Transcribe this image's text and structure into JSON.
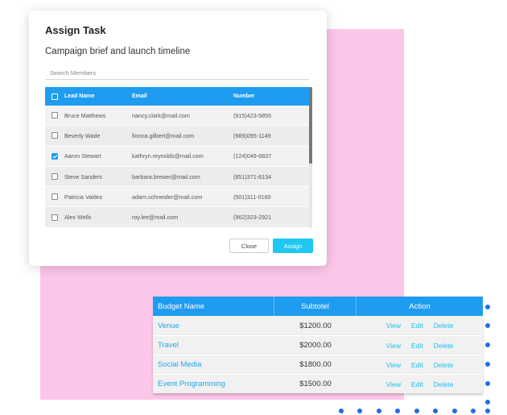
{
  "dialog": {
    "title": "Assign Task",
    "subtitle": "Campaign brief and launch timeline",
    "search_placeholder": "Search Members",
    "columns": [
      "Lead Name",
      "Email",
      "Number"
    ],
    "members": [
      {
        "name": "Bruce Matthews",
        "email": "nancy.clark@mail.com",
        "number": "(915)423-5855",
        "checked": false
      },
      {
        "name": "Beverly Wade",
        "email": "fionna.gilbert@mail.com",
        "number": "(989)095-1149",
        "checked": false
      },
      {
        "name": "Aaron Stewart",
        "email": "kathryn.reynolds@mail.com",
        "number": "(124)049-6837",
        "checked": true
      },
      {
        "name": "Steve Sanders",
        "email": "barbara.brewer@mail.com",
        "number": "(851)371-8134",
        "checked": false
      },
      {
        "name": "Patricia Valdez",
        "email": "adam.schneider@mail.com",
        "number": "(501)311-0160",
        "checked": false
      },
      {
        "name": "Alex Wells",
        "email": "roy.lee@mail.com",
        "number": "(962)323-2921",
        "checked": false
      }
    ],
    "close_label": "Close",
    "assign_label": "Assign"
  },
  "budget": {
    "columns": [
      "Budget Name",
      "Subtotel",
      "Action"
    ],
    "rows": [
      {
        "name": "Venue",
        "subtotal": "$1200.00"
      },
      {
        "name": "Travel",
        "subtotal": "$2000.00"
      },
      {
        "name": "Social Media",
        "subtotal": "$1800.00"
      },
      {
        "name": "Event Programming",
        "subtotal": "$1500.00"
      }
    ],
    "actions": [
      "View",
      "Edit",
      "Delete"
    ]
  },
  "colors": {
    "accent": "#1e9cf0",
    "assign_button": "#1ec8f0",
    "backdrop": "#fcc6e8",
    "dots": "#1f6fe5"
  }
}
